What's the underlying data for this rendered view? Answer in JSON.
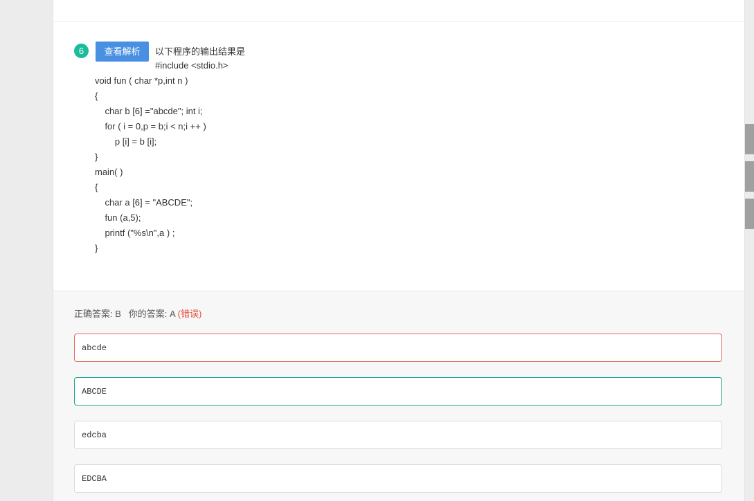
{
  "question": {
    "number": "6",
    "analysis_button": "查看解析",
    "title": "以下程序的输出结果是",
    "code_lines": [
      "#include <stdio.h>",
      "void fun ( char *p,int n )",
      "{",
      "    char b [6] =\"abcde\"; int i;",
      "    for ( i = 0,p = b;i < n;i ++ )",
      "        p [i] = b [i];",
      "}",
      "main( )",
      "{",
      "    char a [6] = \"ABCDE\";",
      "    fun (a,5);",
      "    printf (\"%s\\n\",a ) ;",
      "}"
    ]
  },
  "answer": {
    "correct_label": "正确答案:",
    "correct_value": "B",
    "your_label": "你的答案:",
    "your_value": "A",
    "result": "(错误)"
  },
  "options": [
    {
      "text": "abcde",
      "state": "wrong"
    },
    {
      "text": "ABCDE",
      "state": "right"
    },
    {
      "text": "edcba",
      "state": "normal"
    },
    {
      "text": "EDCBA",
      "state": "normal"
    }
  ],
  "colors": {
    "question_number_bg": "#1abc9c",
    "analysis_button_bg": "#4a90e2",
    "wrong": "#e74c3c",
    "right": "#1aa58a"
  }
}
